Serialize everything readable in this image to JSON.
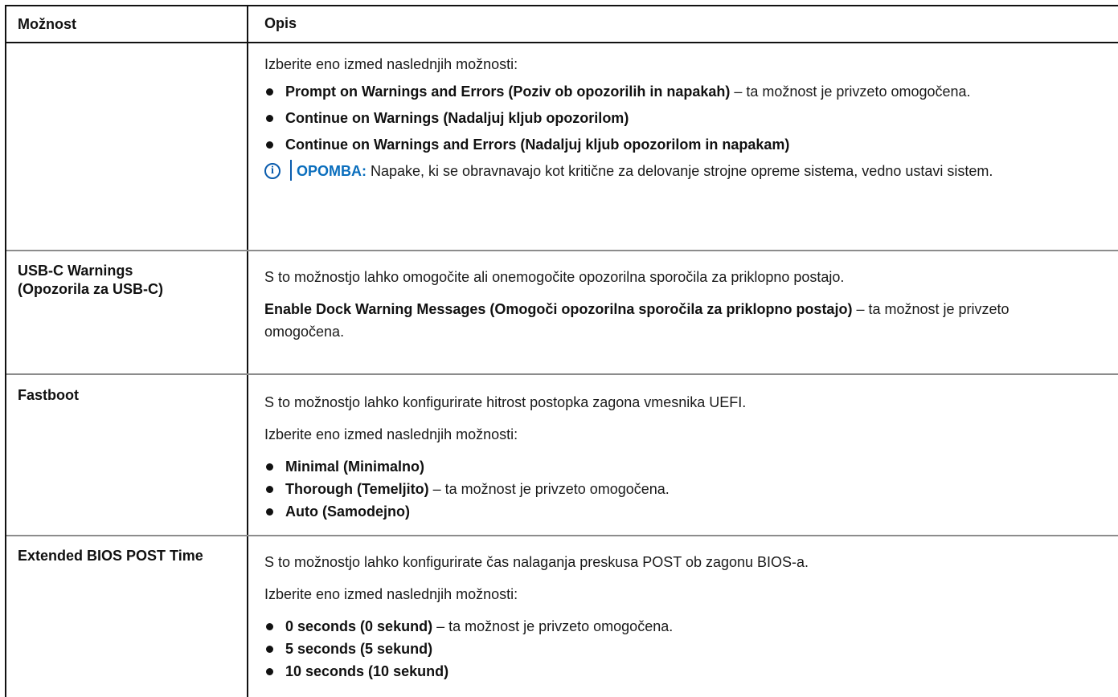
{
  "table": {
    "header": {
      "option": "Možnost",
      "description": "Opis"
    },
    "row1": {
      "option": "",
      "intro": "Izberite eno izmed naslednjih možnosti:",
      "bullets": [
        {
          "name": "Prompt on Warnings and Errors (Poziv ob opozorilih in napakah)",
          "suffix": " – ta možnost je privzeto omogočena."
        },
        {
          "name": "Continue on Warnings (Nadaljuj kljub opozorilom)",
          "suffix": ""
        },
        {
          "name": "Continue on Warnings and Errors (Nadaljuj kljub opozorilom in napakam)",
          "suffix": ""
        }
      ],
      "note": {
        "icon": "info-icon",
        "label": "OPOMBA:",
        "text": " Napake, ki se obravnavajo kot kritične za delovanje strojne opreme sistema, vedno ustavi sistem."
      }
    },
    "row2": {
      "option": "USB-C Warnings (Opozorila za USB-C)",
      "p1": "S to možnostjo lahko omogočite ali onemogočite opozorilna sporočila za priklopno postajo.",
      "p2_bold": "Enable Dock Warning Messages (Omogoči opozorilna sporočila za priklopno postajo)",
      "p2_rest": " – ta možnost je privzeto omogočena."
    },
    "row3": {
      "option": "Fastboot",
      "p1": "S to možnostjo lahko konfigurirate hitrost postopka zagona vmesnika UEFI.",
      "intro": "Izberite eno izmed naslednjih možnosti:",
      "bullets": [
        {
          "name": "Minimal (Minimalno)",
          "suffix": ""
        },
        {
          "name": "Thorough (Temeljito)",
          "suffix": " – ta možnost je privzeto omogočena."
        },
        {
          "name": "Auto (Samodejno)",
          "suffix": ""
        }
      ]
    },
    "row4": {
      "option": "Extended BIOS POST Time",
      "p1": "S to možnostjo lahko konfigurirate čas nalaganja preskusa POST ob zagonu BIOS-a.",
      "intro": "Izberite eno izmed naslednjih možnosti:",
      "bullets": [
        {
          "name": "0 seconds (0 sekund)",
          "suffix": " – ta možnost je privzeto omogočena."
        },
        {
          "name": "5 seconds (5 sekund)",
          "suffix": ""
        },
        {
          "name": "10 seconds (10 sekund)",
          "suffix": ""
        }
      ]
    }
  },
  "colors": {
    "note_blue": "#0a6ebd",
    "border": "#111111",
    "row_divider": "#8c8c8c"
  }
}
